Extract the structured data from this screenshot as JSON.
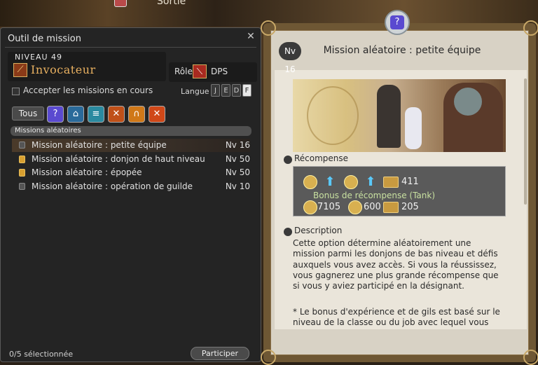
{
  "background": {
    "top_label": "Sortie"
  },
  "left_panel": {
    "title": "Outil de mission",
    "level_label": "NIVEAU 49",
    "job_name": "Invocateur",
    "role_label": "Rôle",
    "role_value": "DPS",
    "accept_checkbox_label": "Accepter les missions en cours",
    "language_label": "Langue",
    "languages": [
      "J",
      "E",
      "D",
      "F"
    ],
    "all_button": "Tous",
    "section_label": "Missions aléatoires",
    "duties": [
      {
        "name": "Mission aléatoire : petite équipe",
        "level": "Nv 16",
        "icon": "checkbox-icon"
      },
      {
        "name": "Mission aléatoire : donjon de haut niveau",
        "level": "Nv 50",
        "icon": "lock-icon"
      },
      {
        "name": "Mission aléatoire : épopée",
        "level": "Nv 50",
        "icon": "lock-icon"
      },
      {
        "name": "Mission aléatoire : opération de guilde",
        "level": "Nv 10",
        "icon": "checkbox-icon"
      }
    ],
    "selected_count": "0/5 sélectionnée",
    "join_button": "Participer"
  },
  "right_panel": {
    "level_badge": "Nv 16",
    "title": "Mission aléatoire : petite équipe",
    "reward_heading": "Récompense",
    "reward_values": {
      "ticket_top": "411",
      "gil": "7105",
      "seals": "600",
      "ticket_bottom": "205"
    },
    "bonus_label": "Bonus de récompense (Tank)",
    "description_heading": "Description",
    "description_p1": "Cette option détermine aléatoirement une mission parmi les donjons de bas niveau et défis auxquels vous avez accès. Si vous la réussissez, vous gagnerez une plus grande récompense que si vous y aviez participé en la désignant.",
    "description_p2": "* Le bonus d'expérience et de gils est basé sur le niveau de la classe ou du job avec lequel vous"
  },
  "colors": {
    "job_accent": "#e8b060",
    "panel_bg": "#242424",
    "parchment": "#eae5da"
  }
}
